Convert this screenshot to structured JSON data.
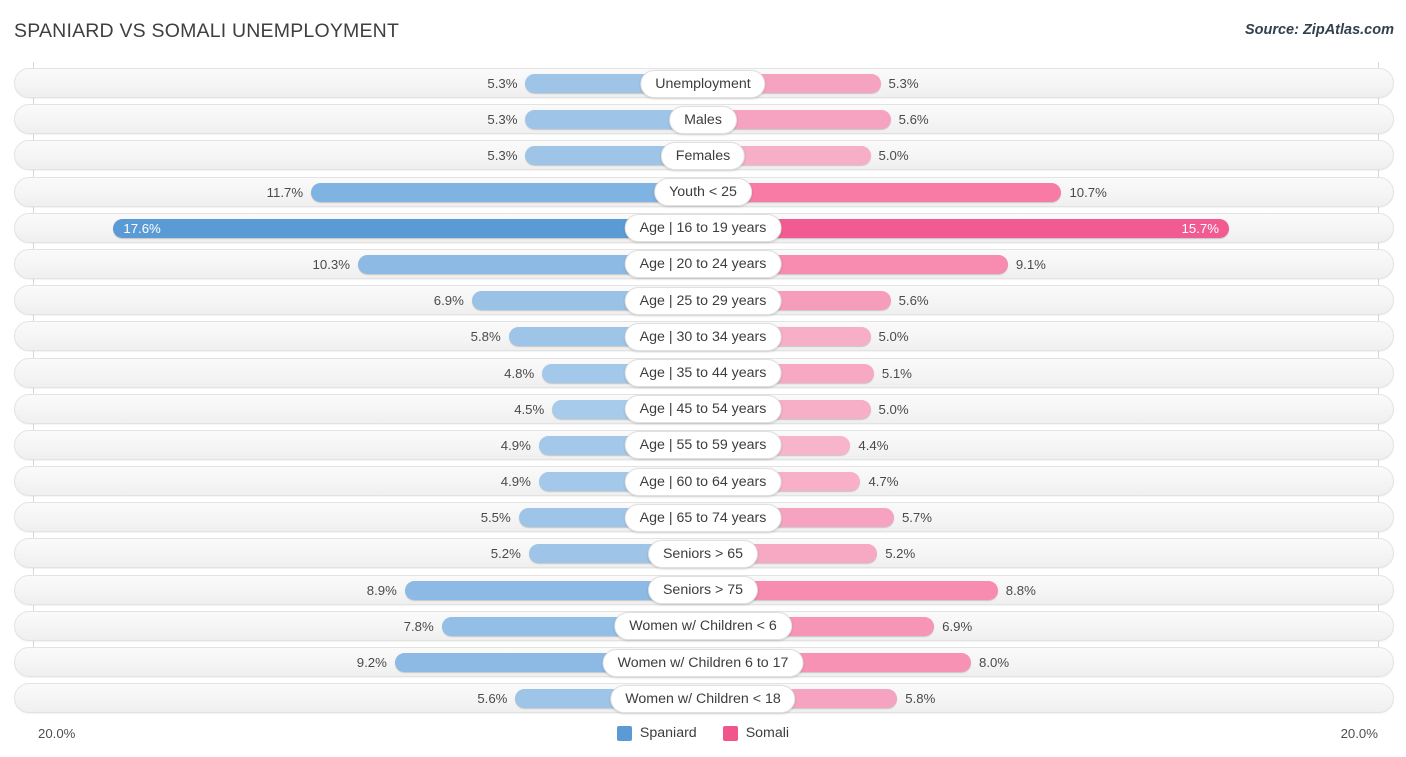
{
  "header": {
    "title": "SPANIARD VS SOMALI UNEMPLOYMENT",
    "source": "Source: ZipAtlas.com"
  },
  "legend": {
    "items": [
      {
        "label": "Spaniard",
        "color": "#5b9bd5"
      },
      {
        "label": "Somali",
        "color": "#f0558c"
      }
    ]
  },
  "axis": {
    "left_label": "20.0%",
    "right_label": "20.0%",
    "max": 20.0
  },
  "chart_data": {
    "type": "bar",
    "subtype": "diverging-bar",
    "title": "SPANIARD VS SOMALI UNEMPLOYMENT",
    "xlabel": "",
    "ylabel": "",
    "xlim": [
      0,
      20.0
    ],
    "grid": true,
    "legend_position": "bottom-center",
    "categories": [
      "Unemployment",
      "Males",
      "Females",
      "Youth < 25",
      "Age | 16 to 19 years",
      "Age | 20 to 24 years",
      "Age | 25 to 29 years",
      "Age | 30 to 34 years",
      "Age | 35 to 44 years",
      "Age | 45 to 54 years",
      "Age | 55 to 59 years",
      "Age | 60 to 64 years",
      "Age | 65 to 74 years",
      "Seniors > 65",
      "Seniors > 75",
      "Women w/ Children < 6",
      "Women w/ Children 6 to 17",
      "Women w/ Children < 18"
    ],
    "series": [
      {
        "name": "Spaniard",
        "side": "left",
        "values": [
          5.3,
          5.3,
          5.3,
          11.7,
          17.6,
          10.3,
          6.9,
          5.8,
          4.8,
          4.5,
          4.9,
          4.9,
          5.5,
          5.2,
          8.9,
          7.8,
          9.2,
          5.6
        ],
        "labels": [
          "5.3%",
          "5.3%",
          "5.3%",
          "11.7%",
          "17.6%",
          "10.3%",
          "6.9%",
          "5.8%",
          "4.8%",
          "4.5%",
          "4.9%",
          "4.9%",
          "5.5%",
          "5.2%",
          "8.9%",
          "7.8%",
          "9.2%",
          "5.6%"
        ]
      },
      {
        "name": "Somali",
        "side": "right",
        "values": [
          5.3,
          5.6,
          5.0,
          10.7,
          15.7,
          9.1,
          5.6,
          5.0,
          5.1,
          5.0,
          4.4,
          4.7,
          5.7,
          5.2,
          8.8,
          6.9,
          8.0,
          5.8
        ],
        "labels": [
          "5.3%",
          "5.6%",
          "5.0%",
          "10.7%",
          "15.7%",
          "9.1%",
          "5.6%",
          "5.0%",
          "5.1%",
          "5.0%",
          "4.4%",
          "4.7%",
          "5.7%",
          "5.2%",
          "8.8%",
          "6.9%",
          "8.0%",
          "5.8%"
        ]
      }
    ]
  },
  "rows": [
    {
      "label": "Unemployment",
      "left": "5.3%",
      "right": "5.3%",
      "left_val": 5.3,
      "right_val": 5.3,
      "left_color": "#9ec5e8",
      "right_color": "#f5a3c0",
      "left_inside": false,
      "right_inside": false
    },
    {
      "label": "Males",
      "left": "5.3%",
      "right": "5.6%",
      "left_val": 5.3,
      "right_val": 5.6,
      "left_color": "#9ec5e8",
      "right_color": "#f5a3c0",
      "left_inside": false,
      "right_inside": false
    },
    {
      "label": "Females",
      "left": "5.3%",
      "right": "5.0%",
      "left_val": 5.3,
      "right_val": 5.0,
      "left_color": "#9ec5e8",
      "right_color": "#f7aec7",
      "left_inside": false,
      "right_inside": false
    },
    {
      "label": "Youth < 25",
      "left": "11.7%",
      "right": "10.7%",
      "left_val": 11.7,
      "right_val": 10.7,
      "left_color": "#7fb3e2",
      "right_color": "#f87ba6",
      "left_inside": false,
      "right_inside": false
    },
    {
      "label": "Age | 16 to 19 years",
      "left": "17.6%",
      "right": "15.7%",
      "left_val": 17.6,
      "right_val": 15.7,
      "left_color": "#5b9bd5",
      "right_color": "#f25b91",
      "left_inside": true,
      "right_inside": true
    },
    {
      "label": "Age | 20 to 24 years",
      "left": "10.3%",
      "right": "9.1%",
      "left_val": 10.3,
      "right_val": 9.1,
      "left_color": "#8cbae5",
      "right_color": "#f78bb0",
      "left_inside": false,
      "right_inside": false
    },
    {
      "label": "Age | 25 to 29 years",
      "left": "6.9%",
      "right": "5.6%",
      "left_val": 6.9,
      "right_val": 5.6,
      "left_color": "#9ac2e7",
      "right_color": "#f79dbc",
      "left_inside": false,
      "right_inside": false
    },
    {
      "label": "Age | 30 to 34 years",
      "left": "5.8%",
      "right": "5.0%",
      "left_val": 5.8,
      "right_val": 5.0,
      "left_color": "#9ec5e8",
      "right_color": "#f7aec7",
      "left_inside": false,
      "right_inside": false
    },
    {
      "label": "Age | 35 to 44 years",
      "left": "4.8%",
      "right": "5.1%",
      "left_val": 4.8,
      "right_val": 5.1,
      "left_color": "#a3c8e9",
      "right_color": "#f7a8c3",
      "left_inside": false,
      "right_inside": false
    },
    {
      "label": "Age | 45 to 54 years",
      "left": "4.5%",
      "right": "5.0%",
      "left_val": 4.5,
      "right_val": 5.0,
      "left_color": "#a7cbea",
      "right_color": "#f7aec7",
      "left_inside": false,
      "right_inside": false
    },
    {
      "label": "Age | 55 to 59 years",
      "left": "4.9%",
      "right": "4.4%",
      "left_val": 4.9,
      "right_val": 4.4,
      "left_color": "#a3c8e9",
      "right_color": "#f8b4cb",
      "left_inside": false,
      "right_inside": false
    },
    {
      "label": "Age | 60 to 64 years",
      "left": "4.9%",
      "right": "4.7%",
      "left_val": 4.9,
      "right_val": 4.7,
      "left_color": "#a3c8e9",
      "right_color": "#f8b0c8",
      "left_inside": false,
      "right_inside": false
    },
    {
      "label": "Age | 65 to 74 years",
      "left": "5.5%",
      "right": "5.7%",
      "left_val": 5.5,
      "right_val": 5.7,
      "left_color": "#9ec5e8",
      "right_color": "#f5a3c0",
      "left_inside": false,
      "right_inside": false
    },
    {
      "label": "Seniors > 65",
      "left": "5.2%",
      "right": "5.2%",
      "left_val": 5.2,
      "right_val": 5.2,
      "left_color": "#9ec5e8",
      "right_color": "#f7a8c3",
      "left_inside": false,
      "right_inside": false
    },
    {
      "label": "Seniors > 75",
      "left": "8.9%",
      "right": "8.8%",
      "left_val": 8.9,
      "right_val": 8.8,
      "left_color": "#8cbae5",
      "right_color": "#f78bb0",
      "left_inside": false,
      "right_inside": false
    },
    {
      "label": "Women w/ Children < 6",
      "left": "7.8%",
      "right": "6.9%",
      "left_val": 7.8,
      "right_val": 6.9,
      "left_color": "#93bee6",
      "right_color": "#f795b6",
      "left_inside": false,
      "right_inside": false
    },
    {
      "label": "Women w/ Children 6 to 17",
      "left": "9.2%",
      "right": "8.0%",
      "left_val": 9.2,
      "right_val": 8.0,
      "left_color": "#8cbae5",
      "right_color": "#f792b4",
      "left_inside": false,
      "right_inside": false
    },
    {
      "label": "Women w/ Children < 18",
      "left": "5.6%",
      "right": "5.8%",
      "left_val": 5.6,
      "right_val": 5.8,
      "left_color": "#9ec5e8",
      "right_color": "#f5a3c0",
      "left_inside": false,
      "right_inside": false
    }
  ]
}
